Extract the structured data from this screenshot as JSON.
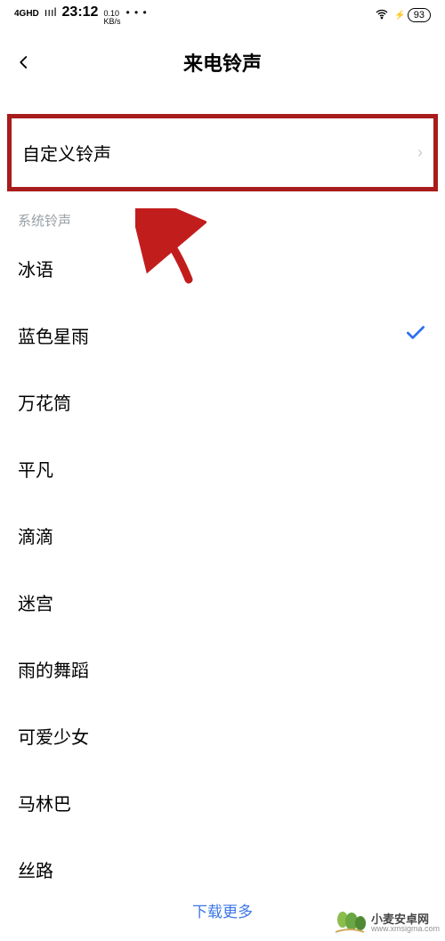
{
  "status": {
    "net_badge": "4GHD",
    "signal": "ıııl",
    "time": "23:12",
    "speed_top": "0.10",
    "speed_bottom": "KB/s",
    "dots": "• • •",
    "battery": "93"
  },
  "nav": {
    "title": "来电铃声"
  },
  "custom": {
    "label": "自定义铃声"
  },
  "section_title": "系统铃声",
  "ringtones": [
    {
      "label": "冰语",
      "selected": false
    },
    {
      "label": "蓝色星雨",
      "selected": true
    },
    {
      "label": "万花筒",
      "selected": false
    },
    {
      "label": "平凡",
      "selected": false
    },
    {
      "label": "滴滴",
      "selected": false
    },
    {
      "label": "迷宫",
      "selected": false
    },
    {
      "label": "雨的舞蹈",
      "selected": false
    },
    {
      "label": "可爱少女",
      "selected": false
    },
    {
      "label": "马林巴",
      "selected": false
    },
    {
      "label": "丝路",
      "selected": false
    }
  ],
  "footer": {
    "more": "下载更多"
  },
  "watermark": {
    "cn": "小麦安卓网",
    "domain": "www.xmsigma.com"
  },
  "annotation": {
    "arrow_color": "#c21d1d"
  }
}
